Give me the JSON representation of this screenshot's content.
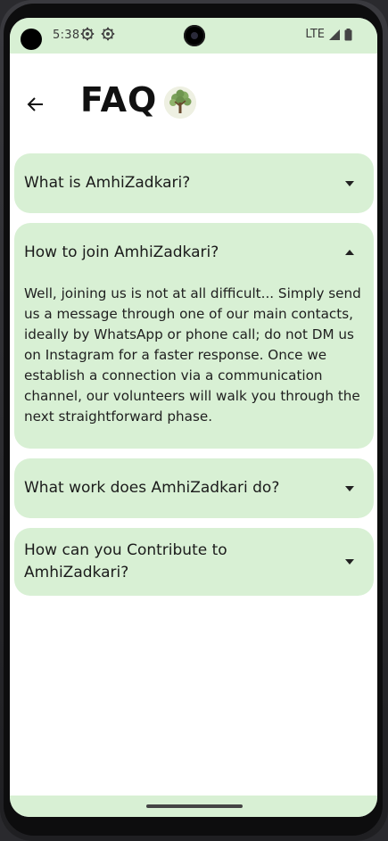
{
  "status_bar": {
    "time": "5:38",
    "network": "LTE",
    "icons": [
      "settings-gear-icon",
      "settings-gear-icon",
      "signal-icon",
      "battery-icon"
    ]
  },
  "header": {
    "title": "FAQ",
    "back_icon": "arrow-left-icon",
    "logo_icon": "tree-logo-icon"
  },
  "faq": [
    {
      "question": "What is AmhiZadkari?",
      "expanded": false,
      "answer": ""
    },
    {
      "question": "How to join AmhiZadkari?",
      "expanded": true,
      "answer": "Well, joining us is not at all difficult... Simply send us a message through one of our main contacts, ideally by WhatsApp or phone call; do not DM us on Instagram for a faster response. Once we establish a connection via a communication channel, our volunteers will walk you through the next straightforward phase."
    },
    {
      "question": "What work does AmhiZadkari do?",
      "expanded": false,
      "answer": ""
    },
    {
      "question": "How can you Contribute to AmhiZadkari?",
      "expanded": false,
      "answer": ""
    }
  ],
  "colors": {
    "accent_surface": "#d8f0d4",
    "text": "#1b1b1b",
    "background": "#ffffff"
  }
}
